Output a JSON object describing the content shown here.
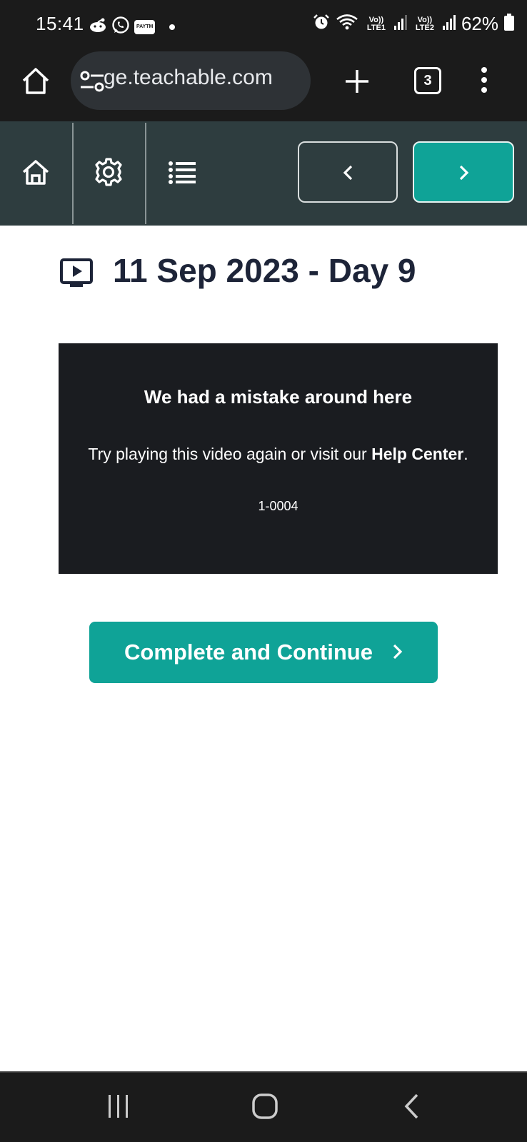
{
  "status_bar": {
    "time": "15:41",
    "paytm_label": "PAYTM",
    "signal1_label": "Vo)) LTE1",
    "signal2_label": "Vo)) LTE2",
    "battery_percent": "62%"
  },
  "browser": {
    "url": "ge.teachable.com",
    "tab_count": "3"
  },
  "lecture": {
    "title": "11 Sep 2023 - Day 9"
  },
  "video_error": {
    "title": "We had a mistake around here",
    "message_prefix": "Try playing this video again or visit our ",
    "help_link": "Help Center",
    "message_suffix": ".",
    "code": "1-0004"
  },
  "cta": {
    "label": "Complete and Continue"
  },
  "colors": {
    "accent": "#0fa397",
    "course_bar": "#2e3d3f",
    "title_text": "#1d2438",
    "video_bg": "#1a1c20"
  }
}
